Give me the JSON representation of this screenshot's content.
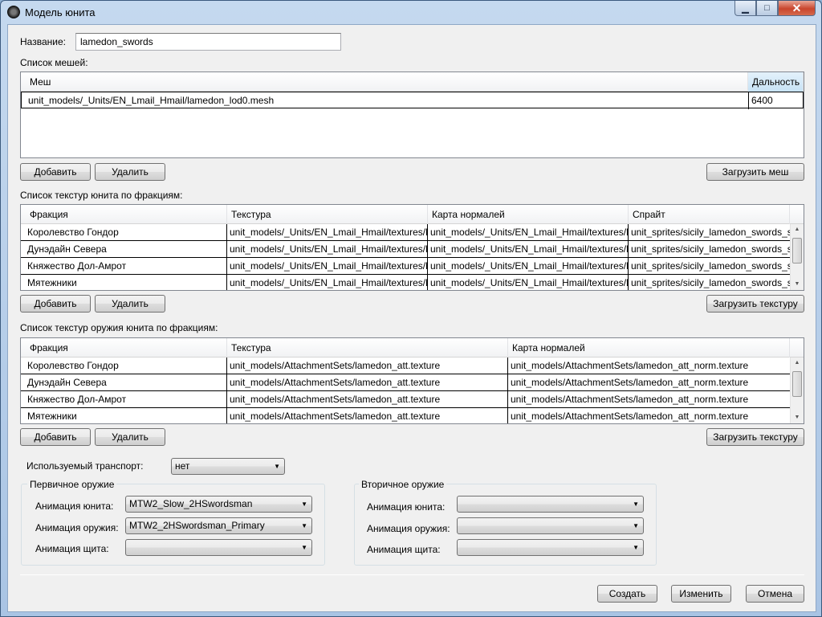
{
  "window": {
    "title": "Модель юнита",
    "minimize": "▁",
    "maximize": "□",
    "close": "✕"
  },
  "name_field": {
    "label": "Название:",
    "value": "lamedon_swords"
  },
  "meshes": {
    "label": "Список мешей:",
    "columns": [
      "Меш",
      "Дальность"
    ],
    "rows": [
      [
        "unit_models/_Units/EN_Lmail_Hmail/lamedon_lod0.mesh",
        "6400"
      ]
    ],
    "add_label": "Добавить",
    "delete_label": "Удалить",
    "load_label": "Загрузить меш"
  },
  "unit_textures": {
    "label": "Список текстур юнита по фракциям:",
    "columns": [
      "Фракция",
      "Текстура",
      "Карта нормалей",
      "Спрайт"
    ],
    "rows": [
      [
        "Королевство Гондор",
        "unit_models/_Units/EN_Lmail_Hmail/textures/l",
        "unit_models/_Units/EN_Lmail_Hmail/textures/l",
        "unit_sprites/sicily_lamedon_swords_s"
      ],
      [
        "Дунэдайн Севера",
        "unit_models/_Units/EN_Lmail_Hmail/textures/l",
        "unit_models/_Units/EN_Lmail_Hmail/textures/l",
        "unit_sprites/sicily_lamedon_swords_s"
      ],
      [
        "Княжество Дол-Амрот",
        "unit_models/_Units/EN_Lmail_Hmail/textures/l",
        "unit_models/_Units/EN_Lmail_Hmail/textures/l",
        "unit_sprites/sicily_lamedon_swords_s"
      ],
      [
        "Мятежники",
        "unit_models/_Units/EN_Lmail_Hmail/textures/l",
        "unit_models/_Units/EN_Lmail_Hmail/textures/l",
        "unit_sprites/sicily_lamedon_swords_s"
      ]
    ],
    "add_label": "Добавить",
    "delete_label": "Удалить",
    "load_label": "Загрузить текстуру"
  },
  "weapon_textures": {
    "label": "Список текстур оружия юнита по фракциям:",
    "columns": [
      "Фракция",
      "Текстура",
      "Карта нормалей"
    ],
    "rows": [
      [
        "Королевство Гондор",
        "unit_models/AttachmentSets/lamedon_att.texture",
        "unit_models/AttachmentSets/lamedon_att_norm.texture"
      ],
      [
        "Дунэдайн Севера",
        "unit_models/AttachmentSets/lamedon_att.texture",
        "unit_models/AttachmentSets/lamedon_att_norm.texture"
      ],
      [
        "Княжество Дол-Амрот",
        "unit_models/AttachmentSets/lamedon_att.texture",
        "unit_models/AttachmentSets/lamedon_att_norm.texture"
      ],
      [
        "Мятежники",
        "unit_models/AttachmentSets/lamedon_att.texture",
        "unit_models/AttachmentSets/lamedon_att_norm.texture"
      ]
    ],
    "add_label": "Добавить",
    "delete_label": "Удалить",
    "load_label": "Загрузить текстуру"
  },
  "transport": {
    "label": "Используемый транспорт:",
    "value": "нет"
  },
  "primary": {
    "title": "Первичное оружие",
    "unit_anim_label": "Анимация юнита:",
    "unit_anim_value": "MTW2_Slow_2HSwordsman",
    "weapon_anim_label": "Анимация оружия:",
    "weapon_anim_value": "MTW2_2HSwordsman_Primary",
    "shield_anim_label": "Анимация щита:",
    "shield_anim_value": ""
  },
  "secondary": {
    "title": "Вторичное оружие",
    "unit_anim_label": "Анимация юнита:",
    "unit_anim_value": "",
    "weapon_anim_label": "Анимация оружия:",
    "weapon_anim_value": "",
    "shield_anim_label": "Анимация щита:",
    "shield_anim_value": ""
  },
  "footer": {
    "create_label": "Создать",
    "change_label": "Изменить",
    "cancel_label": "Отмена"
  }
}
